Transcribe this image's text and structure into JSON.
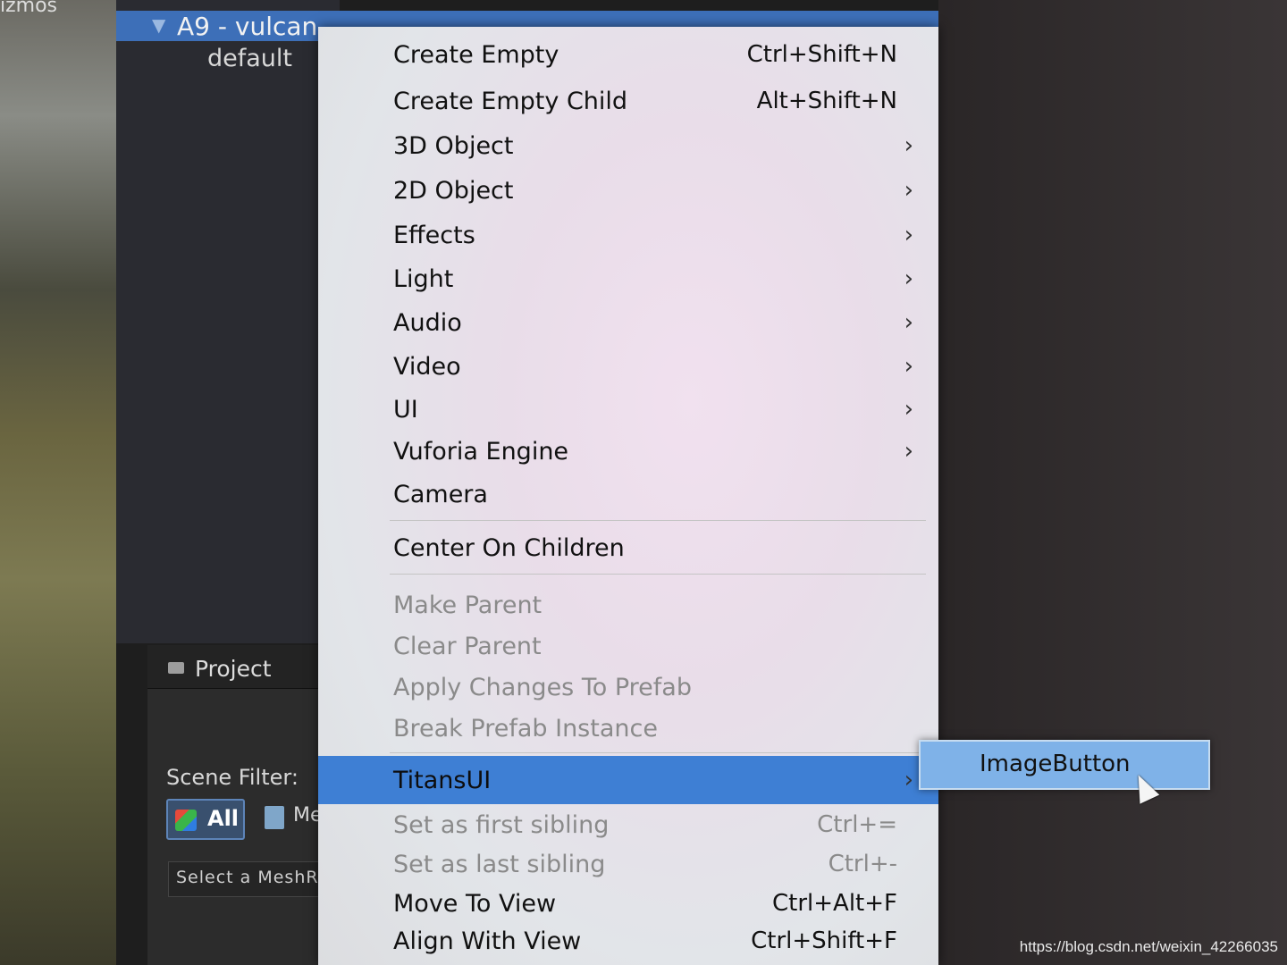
{
  "scene": {
    "gizmos_label": "izmos"
  },
  "hierarchy": {
    "selected_item": "A9 - vulcan",
    "child_item": "default"
  },
  "project": {
    "tab_label": "Project",
    "scene_filter_label": "Scene Filter:",
    "all_label": "All",
    "mesh_label": "Mesh",
    "select_label": "Select a MeshRen"
  },
  "context_menu": {
    "items": [
      {
        "label": "Create Empty",
        "shortcut": "Ctrl+Shift+N"
      },
      {
        "label": "Create Empty Child",
        "shortcut": "Alt+Shift+N"
      },
      {
        "label": "3D Object",
        "arrow": "›"
      },
      {
        "label": "2D Object",
        "arrow": "›"
      },
      {
        "label": "Effects",
        "arrow": "›"
      },
      {
        "label": "Light",
        "arrow": "›"
      },
      {
        "label": "Audio",
        "arrow": "›"
      },
      {
        "label": "Video",
        "arrow": "›"
      },
      {
        "label": "UI",
        "arrow": "›"
      },
      {
        "label": "Vuforia Engine",
        "arrow": "›"
      },
      {
        "label": "Camera"
      },
      {
        "label": "Center On Children"
      },
      {
        "label": "Make Parent",
        "disabled": true
      },
      {
        "label": "Clear Parent",
        "disabled": true
      },
      {
        "label": "Apply Changes To Prefab",
        "disabled": true
      },
      {
        "label": "Break Prefab Instance",
        "disabled": true
      },
      {
        "label": "TitansUI",
        "arrow": "›",
        "highlighted": true
      },
      {
        "label": "Set as first sibling",
        "shortcut": "Ctrl+=",
        "disabled": true
      },
      {
        "label": "Set as last sibling",
        "shortcut": "Ctrl+-",
        "disabled": true
      },
      {
        "label": "Move To View",
        "shortcut": "Ctrl+Alt+F"
      },
      {
        "label": "Align With View",
        "shortcut": "Ctrl+Shift+F"
      }
    ]
  },
  "submenu": {
    "items": [
      {
        "label": "ImageButton"
      }
    ]
  },
  "watermark": "https://blog.csdn.net/weixin_42266035",
  "colors": {
    "highlight": "#3e7fd4",
    "submenu_bg": "#7fb2e8",
    "disabled_text": "#8a8a8a"
  }
}
